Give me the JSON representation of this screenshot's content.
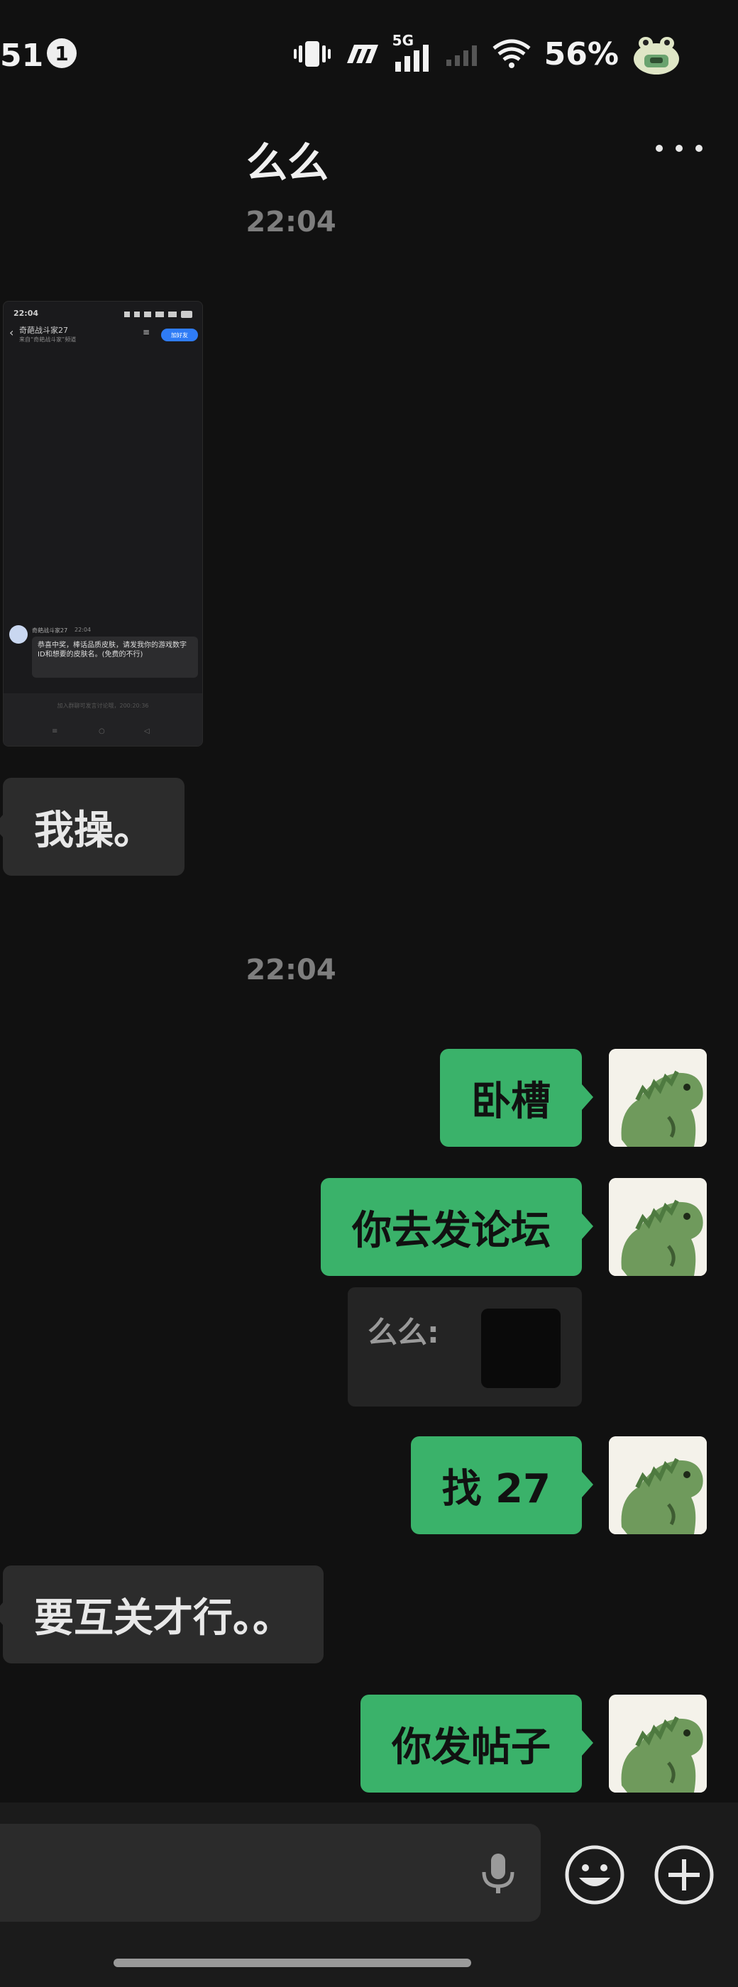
{
  "status_bar": {
    "time": "51",
    "notification_count": "1",
    "network": "5G",
    "battery": "56%"
  },
  "header": {
    "title": "么么"
  },
  "screenshot_thumb": {
    "time": "22:04",
    "title": "奇葩战斗家27",
    "subtitle": "来自“奇葩战斗家”频道",
    "follow_label": "加好友",
    "sender": "奇葩战斗家27",
    "sender_time": "22:04",
    "message": "恭喜中奖，棒话品质皮肤，请发我你的游戏数字ID和想要的皮肤名。(免费的不行)",
    "input_placeholder": "加入群聊可发言讨论哦，200:20:36"
  },
  "timestamps": [
    "22:04",
    "22:04"
  ],
  "messages": [
    {
      "side": "in",
      "text": "我操。"
    },
    {
      "side": "out",
      "text": "卧槽"
    },
    {
      "side": "out",
      "text": "你去发论坛"
    },
    {
      "side": "out",
      "text": "找 27"
    },
    {
      "side": "in",
      "text": "要互关才行。。"
    },
    {
      "side": "out",
      "text": "你发帖子"
    }
  ],
  "quote": {
    "label": "么么:"
  },
  "colors": {
    "background": "#111111",
    "outgoing_bubble": "#3ab26a",
    "incoming_bubble": "#2c2c2c",
    "timestamp": "#7e7e7e"
  },
  "icons": {
    "voice": "microphone-icon",
    "emoji": "emoji-icon",
    "more": "plus-icon"
  }
}
